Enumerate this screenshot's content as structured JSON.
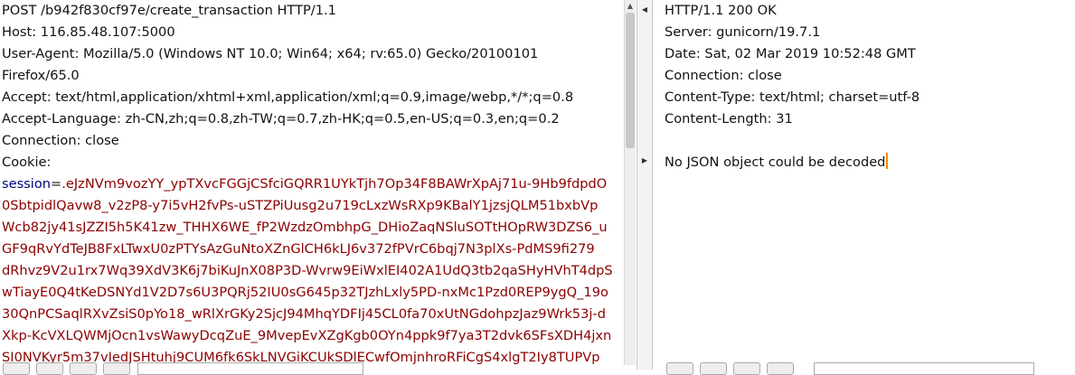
{
  "request": {
    "lines": [
      "POST /b942f830cf97e/create_transaction HTTP/1.1",
      "Host: 116.85.48.107:5000",
      "User-Agent: Mozilla/5.0 (Windows NT 10.0; Win64; x64; rv:65.0) Gecko/20100101",
      "Firefox/65.0",
      "Accept: text/html,application/xhtml+xml,application/xml;q=0.9,image/webp,*/*;q=0.8",
      "Accept-Language: zh-CN,zh;q=0.8,zh-TW;q=0.7,zh-HK;q=0.5,en-US;q=0.3,en;q=0.2",
      "Connection: close",
      "Cookie:"
    ],
    "cookie_name": "session",
    "cookie_eq": "=",
    "cookie_lines": [
      ".eJzNVm9vozYY_ypTXvcFGGjCSfciGQRR1UYkTjh7Op34F8BAWrXpAj71u-9Hb9fdpdO",
      "0SbtpidlQavw8_v2zP8-y7i5vH2fvPs-uSTZPiUusg2u719cLxzWsRXp9KBalY1jzsjQLM51bxbVp",
      "Wcb82jy41sJZZI5h5K41zw_THHX6WE_fP2WzdzOmbhpG_DHioZaqNSluSOTtHOpRW3DZS6_u",
      "GF9qRvYdTeJB8FxLTwxU0zPTYsAzGuNtoXZnGlCH6kLJ6v372fPVrC6bqj7N3plXs-PdMS9fi279",
      "dRhvz9V2u1rx7Wq39XdV3K6j7biKuJnX08P3D-Wvrw9EiWxlEI402A1UdQ3tb2qaSHyHVhT4dpS",
      "wTiayE0Q4tKeDSNYd1V2D7s6U3PQRj52IU0sG645p32TJzhLxly5PD-nxMc1Pzd0REP9ygQ_19o",
      "30QnPCSaqlRXvZsiS0pYo18_wRlXrGKy2SjcJ94MhqYDFIj45CL0fa70xUtNGdohpzJaz9Wrk53j-d",
      "Xkp-KcVXLQWMjOcn1vsWawyDcqZuE_9MvepEvXZgKgb0OYn4ppk9f7ya3T2dvk6SFsXDH4jxn",
      "SI0NVKyr5m37vIedJSHtuhj9CUM6fk6SkLNVGiKCUkSDlECwfOmjnhroRFiCgS4xlgT2Iy8TUPVp"
    ]
  },
  "response": {
    "lines": [
      "HTTP/1.1 200 OK",
      "Server: gunicorn/19.7.1",
      "Date: Sat, 02 Mar 2019 10:52:48 GMT",
      "Connection: close",
      "Content-Type: text/html; charset=utf-8",
      "Content-Length: 31",
      "",
      "No JSON object could be decoded"
    ]
  }
}
